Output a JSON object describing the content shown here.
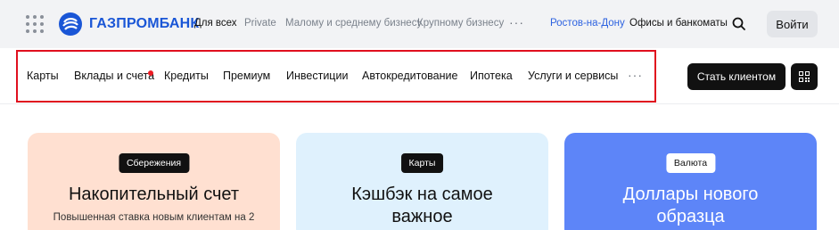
{
  "header": {
    "brand": "ГАЗПРОМБАНК",
    "nav": [
      {
        "label": "Для всех",
        "active": true
      },
      {
        "label": "Private"
      },
      {
        "label": "Малому и среднему бизнесу"
      },
      {
        "label": "Крупному бизнесу"
      }
    ],
    "more": "···",
    "city": "Ростов-на-Дону",
    "offices": "Офисы и банкоматы",
    "login": "Войти",
    "accent_color": "#2d62e0"
  },
  "main_nav": {
    "items": [
      {
        "label": "Карты"
      },
      {
        "label": "Вклады и счета",
        "has_notification": true
      },
      {
        "label": "Кредиты"
      },
      {
        "label": "Премиум"
      },
      {
        "label": "Инвестиции"
      },
      {
        "label": "Автокредитование"
      },
      {
        "label": "Ипотека"
      },
      {
        "label": "Услуги и сервисы"
      }
    ],
    "more": "···",
    "become_client": "Стать клиентом",
    "highlight_color": "#e0101e"
  },
  "cards": [
    {
      "badge": "Сбережения",
      "title": "Накопительный счет",
      "subtitle": "Повышенная ставка новым клиентам на 2",
      "bg": "#ffe0d1"
    },
    {
      "badge": "Карты",
      "title": "Кэшбэк на самое важное",
      "bg": "#dff1fd"
    },
    {
      "badge": "Валюта",
      "title": "Доллары нового образца",
      "bg": "#5d85f8"
    }
  ]
}
